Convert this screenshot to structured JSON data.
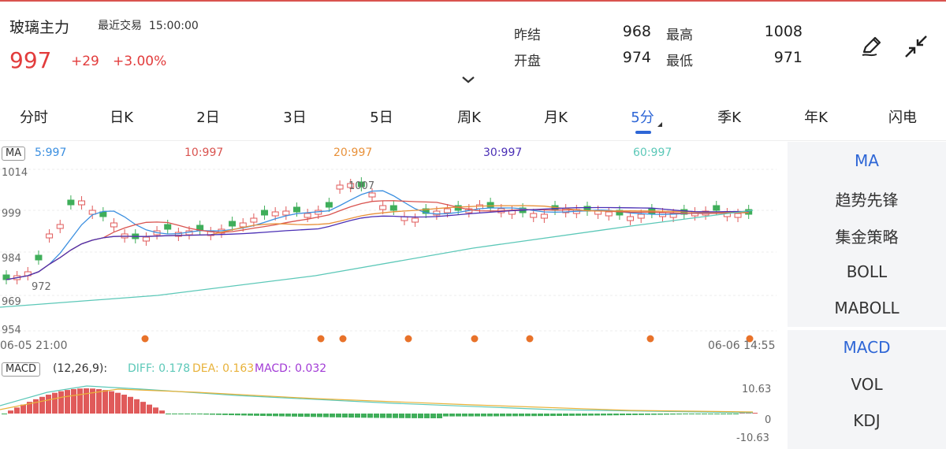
{
  "header": {
    "title": "玻璃主力",
    "recent_label": "最近交易",
    "recent_time": "15:00:00",
    "price": "997",
    "change": "+29",
    "change_pct": "+3.00%"
  },
  "stats": {
    "prev_close_label": "昨结",
    "prev_close": "968",
    "high_label": "最高",
    "high": "1008",
    "open_label": "开盘",
    "open": "974",
    "low_label": "最低",
    "low": "971"
  },
  "tabs": [
    "分时",
    "日K",
    "2日",
    "3日",
    "5日",
    "周K",
    "月K",
    "5分",
    "季K",
    "年K",
    "闪电"
  ],
  "active_tab": "5分",
  "ma": {
    "badge": "MA",
    "ma5": "5:997",
    "ma10": "10:997",
    "ma20": "20:997",
    "ma30": "30:997",
    "ma60": "60:997",
    "colors": {
      "ma5": "#3b8fe0",
      "ma10": "#d9534f",
      "ma20": "#e8913a",
      "ma30": "#4a2fb5",
      "ma60": "#5cc8b8"
    }
  },
  "price_axis": [
    "1014",
    "999",
    "984",
    "969",
    "954"
  ],
  "annotations": {
    "high_mark": "1007",
    "low_mark": "972"
  },
  "time_axis": {
    "start": "06-05 21:00",
    "end": "06-06 14:55"
  },
  "macd": {
    "badge": "MACD",
    "params": "(12,26,9):",
    "diff": "DIFF: 0.178",
    "dea": "DEA: 0.163",
    "macd": "MACD: 0.032",
    "axis": [
      "10.63",
      "0",
      "-10.63"
    ],
    "colors": {
      "diff": "#5cc8b8",
      "dea": "#e8b23a",
      "macd": "#a23bd6"
    }
  },
  "side_panel_top": [
    "MA",
    "趋势先锋",
    "集金策略",
    "BOLL",
    "MABOLL"
  ],
  "side_panel_bottom": [
    "MACD",
    "VOL",
    "KDJ"
  ],
  "chart_data": {
    "type": "candlestick",
    "ylim": [
      954,
      1014
    ],
    "macd_ylim": [
      -10.63,
      10.63
    ]
  }
}
